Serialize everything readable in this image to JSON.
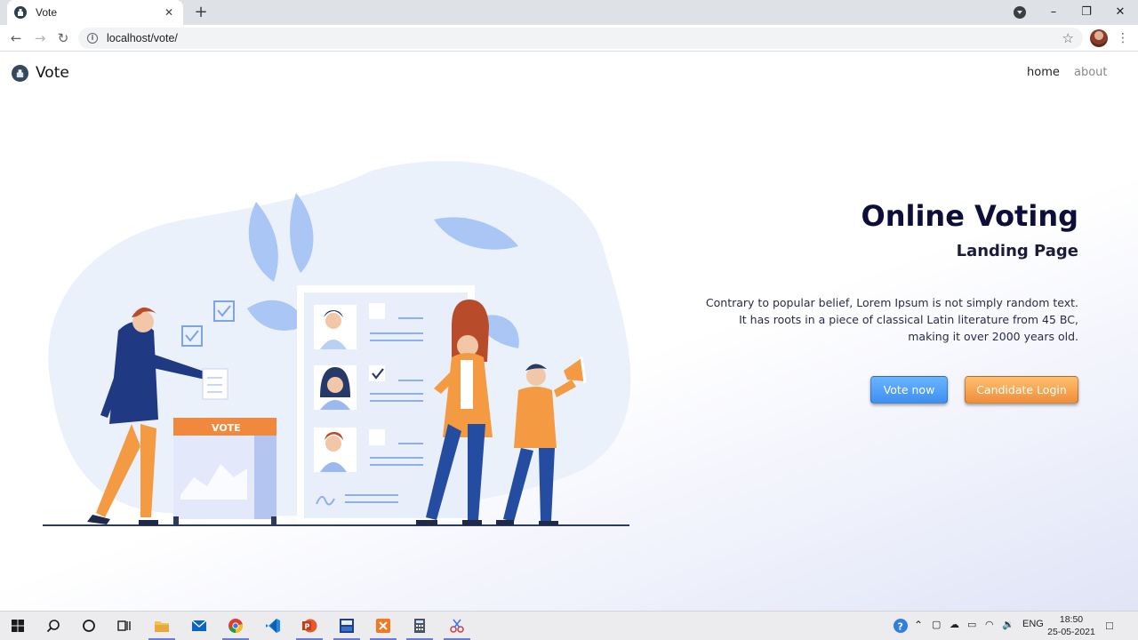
{
  "browser": {
    "tab_title": "Vote",
    "tab_close": "✕",
    "new_tab": "+",
    "url": "localhost/vote/",
    "icons": [
      "favicon-ballot-icon",
      "tab-search-icon",
      "minimize-icon",
      "maximize-icon",
      "close-window-icon",
      "back-icon",
      "forward-icon",
      "reload-icon",
      "info-icon",
      "bookmark-star-icon",
      "profile-avatar",
      "menu-kebab-icon"
    ]
  },
  "navbar": {
    "brand": "Vote",
    "links": [
      "home",
      "about"
    ]
  },
  "hero": {
    "title": "Online Voting",
    "subtitle": "Landing Page",
    "description": "Contrary to popular belief, Lorem Ipsum is not simply random text. It has roots in a piece of classical Latin literature from 45 BC, making it over 2000 years old.",
    "buttons": {
      "primary": "Vote now",
      "secondary": "Candidate Login"
    },
    "colors": {
      "title": "#0e0e3a",
      "primary_button": "#4a9af5",
      "secondary_button": "#f4a04e"
    }
  },
  "illustration": {
    "box_label": "VOTE"
  },
  "taskbar": {
    "apps": [
      "windows-start-icon",
      "search-icon",
      "cortana-icon",
      "task-view-icon",
      "file-explorer-icon",
      "mail-icon",
      "chrome-icon",
      "vscode-icon",
      "powerpoint-icon",
      "devcpp-icon",
      "xampp-icon",
      "calculator-icon",
      "snipping-tool-icon"
    ],
    "language": "ENG",
    "time": "18:50",
    "date": "25-05-2021"
  }
}
